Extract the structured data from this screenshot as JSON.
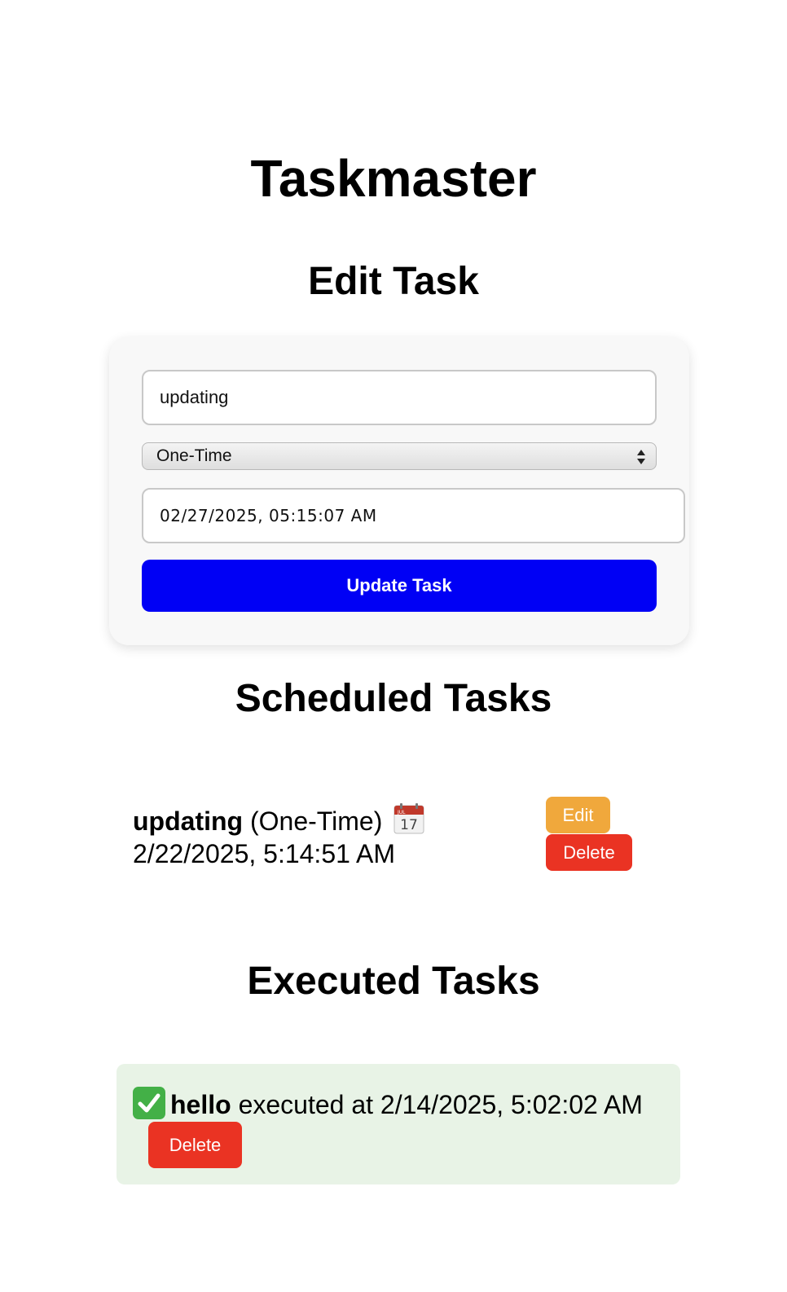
{
  "app": {
    "title": "Taskmaster"
  },
  "edit_section": {
    "title": "Edit Task",
    "task_name_value": "updating",
    "type_select_value": "One-Time",
    "datetime_value": "02/27/2025, 05:15:07 AM",
    "submit_label": "Update Task"
  },
  "scheduled_section": {
    "title": "Scheduled Tasks",
    "tasks": [
      {
        "name": "updating",
        "type": "(One-Time)",
        "icon": "calendar-icon",
        "icon_month": "JUL",
        "icon_day": "17",
        "datetime": "2/22/2025, 5:14:51 AM",
        "edit_label": "Edit",
        "delete_label": "Delete"
      }
    ]
  },
  "executed_section": {
    "title": "Executed Tasks",
    "tasks": [
      {
        "icon": "check-mark-icon",
        "name": "hello",
        "text": "executed at 2/14/2025, 5:02:02 AM",
        "delete_label": "Delete"
      }
    ]
  },
  "colors": {
    "primary_button": "#0000f5",
    "edit_button": "#f0a83c",
    "delete_button": "#ea3323",
    "executed_background": "#e8f3e6",
    "check_icon": "#43b047"
  }
}
